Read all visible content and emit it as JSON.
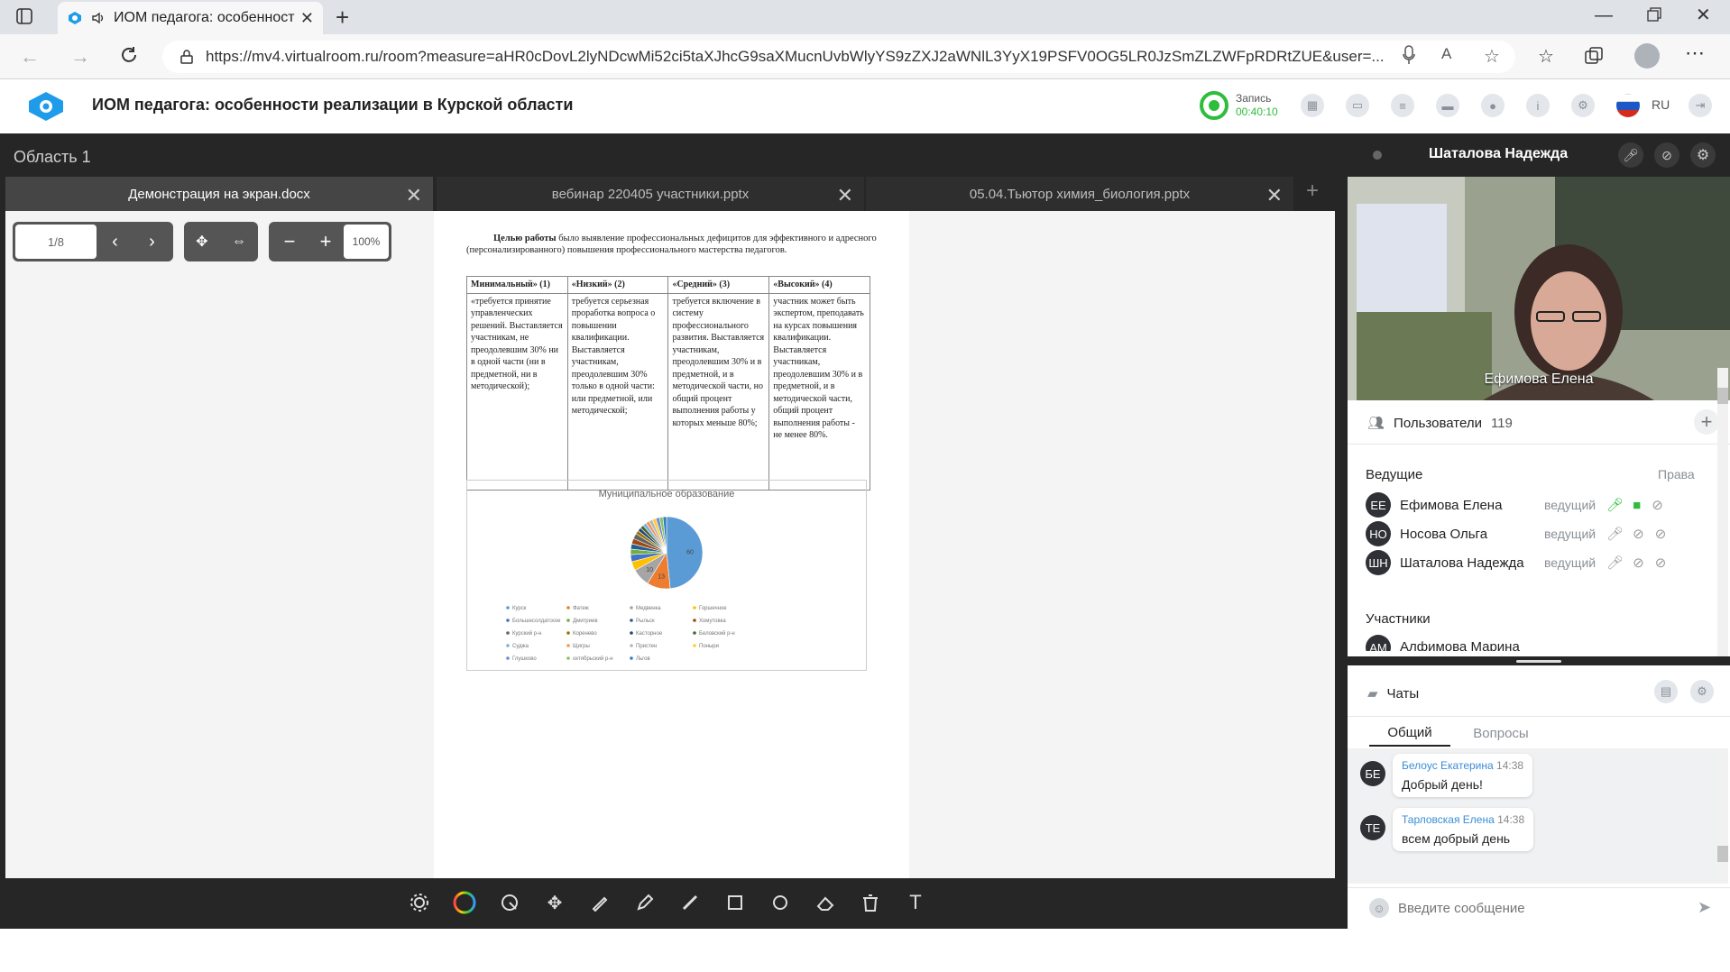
{
  "browser": {
    "tab_title": "ИОМ педагога: особенност",
    "url": "https://mv4.virtualroom.ru/room?measure=aHR0cDovL2lyNDcwMi52ci5taXJhcG9saXMucnUvbWlyYS9zZXJ2aWNlL3YyX19PSFV0OG5LR0JzSmZLZWFpRDRtZUE&user=..."
  },
  "app": {
    "title": "ИОМ педагога: особенности реализации в Курской области",
    "record_label": "Запись",
    "record_time": "00:40:10",
    "lang": "RU"
  },
  "workspace": {
    "area_label": "Область 1",
    "tabs": [
      {
        "label": "Демонстрация на экран.docx"
      },
      {
        "label": "вебинар 220405 участники.pptx"
      },
      {
        "label": "05.04.Тьютор химия_биология.pptx"
      }
    ],
    "page_indicator": "1/8",
    "zoom": "100%"
  },
  "document": {
    "intro_bold": "Целью работы",
    "intro_text": " было выявление профессиональных дефицитов для эффективного и адресного (персонализированного) повышения профессионального мастерства педагогов.",
    "table": {
      "headers": [
        "Минимальный» (1)",
        "«Низкий» (2)",
        "«Средний» (3)",
        "«Высокий» (4)"
      ],
      "cells": [
        "«требуется принятие управленческих решений. Выставляется участникам, не преодолевшим 30% ни в одной части (ни в предметной, ни в методической);",
        "требуется серьезная проработка вопроса о повышении квалификации. Выставляется участникам, преодолевшим 30% только в одной части: или предметной, или методической;",
        "требуется включение в систему профессионального развития. Выставляется участникам, преодолевшим 30% и в предметной, и в методической части, но общий процент выполнения работы у которых меньше 80%;",
        "участник может быть экспертом, преподавать на курсах повышения квалификации. Выставляется участникам, преодолевшим 30% и в предметной, и в методической части, общий процент выполнения работы - не менее 80%."
      ]
    }
  },
  "chart_data": {
    "type": "pie",
    "title": "Муниципальное образование",
    "categories": [
      "Курск",
      "Фатеж",
      "Медвенка",
      "Горшечное",
      "Большесолдатское",
      "Дмитриев",
      "Рыльск",
      "Хомутовка",
      "Курский р-н",
      "Кореневo",
      "Касторное",
      "Беловский р-н",
      "Суджа",
      "Щигры",
      "Пристен",
      "Поныри",
      "Глушково",
      "октябрьский р-н",
      "Льгов"
    ],
    "values": [
      60,
      13,
      10,
      5,
      4,
      3,
      3,
      3,
      3,
      2,
      2,
      2,
      2,
      2,
      2,
      2,
      2,
      2,
      2
    ],
    "data_labels": [
      "60",
      "13",
      "10"
    ],
    "colors": [
      "#5b9bd5",
      "#ed7d31",
      "#a5a5a5",
      "#ffc000",
      "#4472c4",
      "#70ad47",
      "#255e91",
      "#9e480e",
      "#636363",
      "#997300",
      "#264478",
      "#43682b",
      "#7cafdd",
      "#f1975a",
      "#b7b7b7",
      "#ffcd33",
      "#698ed0",
      "#8cc168",
      "#327dc2"
    ],
    "legend": "bottom"
  },
  "right_panel": {
    "speaker_name": "Шаталова Надежда",
    "video_label": "Ефимова Елена",
    "users_label": "Пользователи",
    "users_count": "119",
    "hosts_label": "Ведущие",
    "rights_label": "Права",
    "hosts": [
      {
        "initials": "ЕЕ",
        "name": "Ефимова Елена",
        "role": "ведущий"
      },
      {
        "initials": "НО",
        "name": "Носова Ольга",
        "role": "ведущий"
      },
      {
        "initials": "ШН",
        "name": "Шаталова Надежда",
        "role": "ведущий"
      }
    ],
    "participants_label": "Участники",
    "participants": [
      {
        "initials": "АМ",
        "name": "Алфимова Марина"
      }
    ],
    "chats_label": "Чаты",
    "chat_tabs": [
      "Общий",
      "Вопросы"
    ],
    "messages": [
      {
        "initials": "БЕ",
        "author": "Белоус Екатерина",
        "time": "14:38",
        "text": "Добрый день!"
      },
      {
        "initials": "ТЕ",
        "author": "Тарловская Елена",
        "time": "14:38",
        "text": "всем добрый день"
      }
    ],
    "message_placeholder": "Введите сообщение"
  },
  "colors": {
    "accent_green": "#2ebd3c",
    "dark": "#262626",
    "link_blue": "#3a8dd6"
  }
}
